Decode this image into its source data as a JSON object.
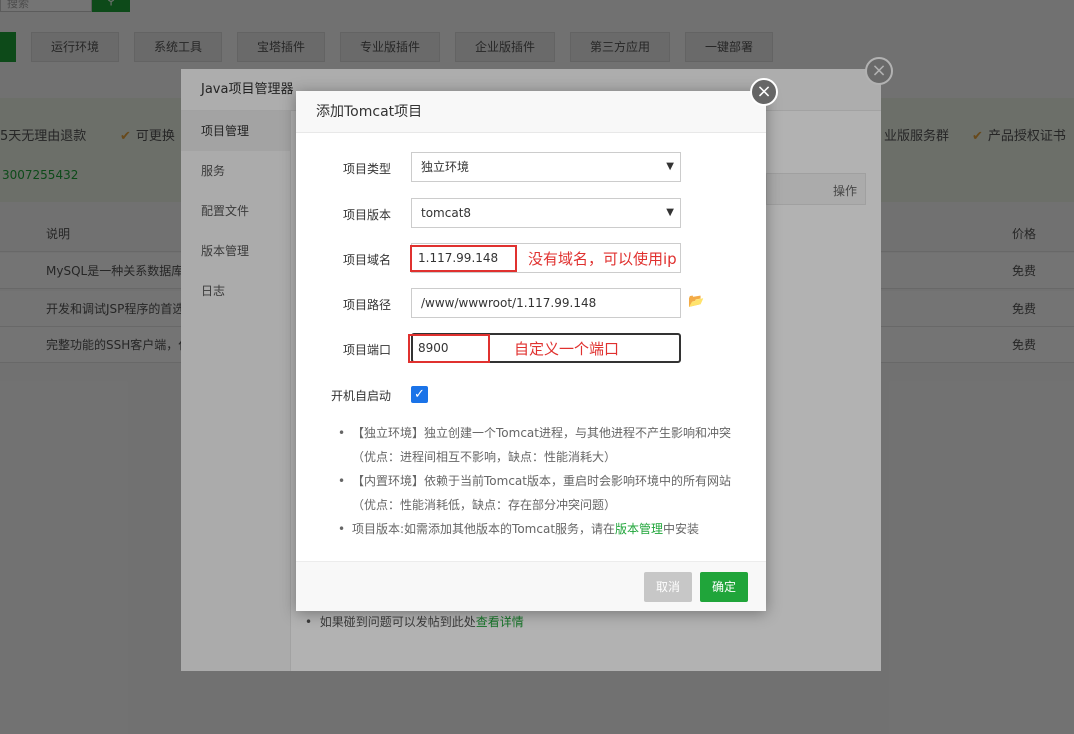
{
  "background": {
    "search_placeholder": "搜索",
    "search_icon": "search-icon",
    "categories": [
      "运行环境",
      "系统工具",
      "宝塔插件",
      "专业版插件",
      "企业版插件",
      "第三方应用",
      "一键部署"
    ],
    "band_left": "5天无理由退款",
    "band_mid": "可更换",
    "band_right1": "业版服务群",
    "band_right2": "产品授权证书",
    "qq": "3007255432",
    "col_desc": "说明",
    "col_price": "价格",
    "rows": [
      {
        "desc": "MySQL是一种关系数据库",
        "price": "免费"
      },
      {
        "desc": "开发和调试JSP程序的首选",
        "price": "免费"
      },
      {
        "desc": "完整功能的SSH客户端，仅",
        "price": "免费"
      }
    ]
  },
  "java_manager": {
    "title": "Java项目管理器",
    "menu": [
      "项目管理",
      "服务",
      "配置文件",
      "版本管理",
      "日志"
    ],
    "op_label": "操作",
    "tip_text": "如果碰到问题可以发帖到此处",
    "tip_link": "查看详情"
  },
  "modal": {
    "title": "添加Tomcat项目",
    "close_label": "×",
    "fields": {
      "type_label": "项目类型",
      "type_value": "独立环境",
      "version_label": "项目版本",
      "version_value": "tomcat8",
      "domain_label": "项目域名",
      "domain_value": "1.117.99.148",
      "domain_annotation": "没有域名，可以使用ip",
      "path_label": "项目路径",
      "path_value": "/www/wwwroot/1.117.99.148",
      "port_label": "项目端口",
      "port_value": "8900",
      "port_annotation": "自定义一个端口",
      "autostart_label": "开机自启动",
      "autostart_checked": true
    },
    "notes": [
      "【独立环境】独立创建一个Tomcat进程，与其他进程不产生影响和冲突（优点：进程间相互不影响，缺点：性能消耗大）",
      "【内置环境】依赖于当前Tomcat版本，重启时会影响环境中的所有网站（优点：性能消耗低，缺点：存在部分冲突问题）"
    ],
    "note3_prefix": "项目版本:如需添加其他版本的Tomcat服务，请在",
    "note3_link": "版本管理",
    "note3_suffix": "中安装",
    "cancel_label": "取消",
    "confirm_label": "确定"
  },
  "colors": {
    "accent": "#20a53a",
    "annotation": "#e0312f",
    "checkbox": "#1a73e8"
  }
}
